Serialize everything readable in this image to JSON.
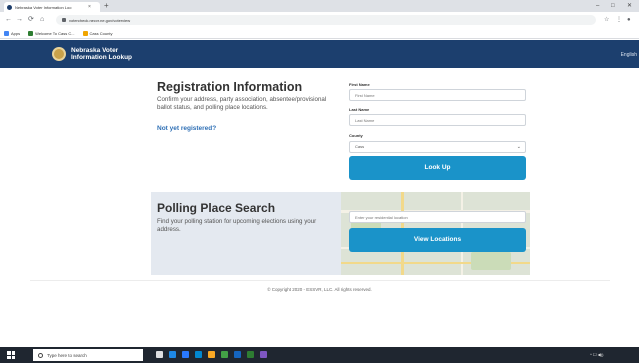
{
  "browser": {
    "tab_title": "Nebraska Voter Information Loo",
    "tab_close": "×",
    "new_tab": "+",
    "window_controls": {
      "minimize": "–",
      "maximize": "□",
      "close": "✕"
    },
    "nav": {
      "back": "←",
      "forward": "→",
      "reload": "⟳",
      "home": "⌂"
    },
    "url": "votercheck.necvr.ne.gov/voterview",
    "toolbar_right": [
      "☆",
      "⋮",
      "●"
    ],
    "bookmarks": [
      {
        "label": "Apps",
        "color": "#4285f4"
      },
      {
        "label": "Welcome To Cass C...",
        "color": "#2e7d32"
      },
      {
        "label": "Cass County",
        "color": "#f0a500"
      }
    ]
  },
  "header": {
    "title_line1": "Nebraska Voter",
    "title_line2": "Information Lookup",
    "language": "English"
  },
  "registration": {
    "title": "Registration Information",
    "description": "Confirm your address, party association, absentee/provisional ballot status, and polling place locations.",
    "not_registered_link": "Not yet registered?",
    "first_name_label": "First Name",
    "first_name_placeholder": "First Name",
    "last_name_label": "Last Name",
    "last_name_placeholder": "Last Name",
    "county_label": "County",
    "county_value": "Cass",
    "lookup_button": "Look Up"
  },
  "polling": {
    "title": "Polling Place Search",
    "description": "Find your polling station for upcoming elections using your address.",
    "address_placeholder": "Enter your residential location",
    "view_button": "View Locations"
  },
  "footer": {
    "copyright": "© Copyright 2020 - ESSVR, LLC. All rights reserved."
  },
  "taskbar": {
    "search_placeholder": "Type here to search",
    "apps": [
      {
        "name": "task-view-icon",
        "color": "#ffffff"
      },
      {
        "name": "edge-icon",
        "color": "#1e88e5"
      },
      {
        "name": "store-icon",
        "color": "#2979ff"
      },
      {
        "name": "mail-icon",
        "color": "#0288d1"
      },
      {
        "name": "explorer-icon",
        "color": "#f9a825"
      },
      {
        "name": "chrome-icon",
        "color": "#43a047"
      },
      {
        "name": "outlook-icon",
        "color": "#1565c0"
      },
      {
        "name": "excel-icon",
        "color": "#2e7d32"
      },
      {
        "name": "photos-icon",
        "color": "#7e57c2"
      }
    ],
    "tray": "^ ☐ ◀))"
  },
  "colors": {
    "header_bg": "#1c3f6e",
    "accent_button": "#1a93c9",
    "link": "#2e6fb5"
  }
}
